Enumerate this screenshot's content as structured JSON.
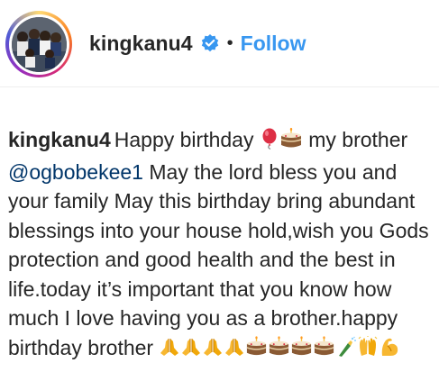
{
  "post": {
    "username": "kingkanu4",
    "separator": "•",
    "follow_label": "Follow",
    "verified_icon": "verified-badge-icon",
    "accent_color": "#3897f0"
  },
  "caption": {
    "author": "kingkanu4",
    "text_1": "Happy birthday ",
    "text_2": " my brother ",
    "mention": "@ogbobekee1",
    "text_3": " May the lord bless you and your family May this birthday bring abundant blessings into your house hold,wish you Gods protection and good health and the best in life.today it’s important that you know how much I love having you as a brother.happy birthday brother ",
    "emojis_1": [
      "balloon-emoji",
      "birthday-cake-emoji"
    ],
    "emojis_2": [
      "folded-hands-emoji",
      "folded-hands-emoji",
      "folded-hands-emoji",
      "folded-hands-emoji",
      "birthday-cake-emoji",
      "birthday-cake-emoji",
      "birthday-cake-emoji",
      "birthday-cake-emoji",
      "champagne-emoji",
      "raising-hands-emoji",
      "flexed-biceps-emoji"
    ]
  }
}
